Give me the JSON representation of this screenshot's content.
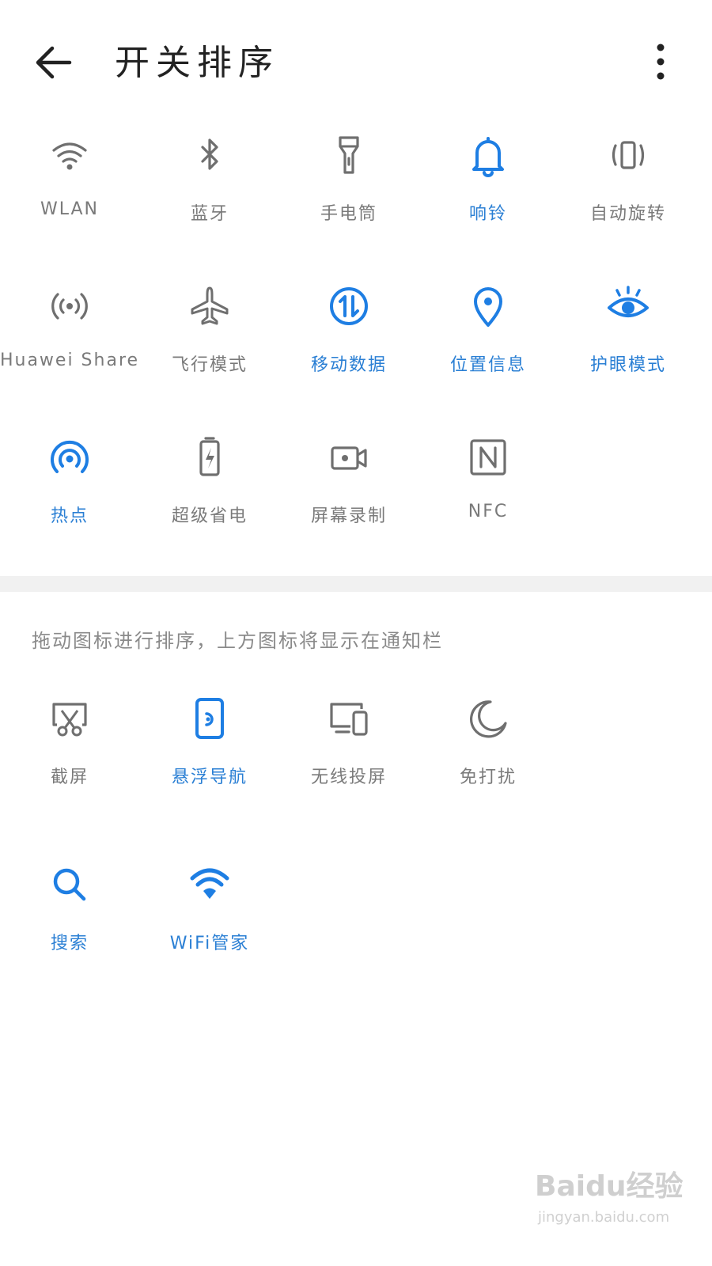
{
  "header": {
    "title": "开关排序"
  },
  "colors": {
    "active": "#1e7ee3",
    "inactive": "#6f6f6f",
    "background": "#ffffff",
    "divider": "#f1f1f1"
  },
  "top_tiles": [
    {
      "label": "WLAN",
      "icon": "wifi-icon",
      "active": false
    },
    {
      "label": "蓝牙",
      "icon": "bluetooth-icon",
      "active": false
    },
    {
      "label": "手电筒",
      "icon": "flashlight-icon",
      "active": false
    },
    {
      "label": "响铃",
      "icon": "bell-icon",
      "active": true
    },
    {
      "label": "自动旋转",
      "icon": "rotate-icon",
      "active": false
    },
    {
      "label": "Huawei Share",
      "icon": "huawei-share-icon",
      "active": false
    },
    {
      "label": "飞行模式",
      "icon": "airplane-icon",
      "active": false
    },
    {
      "label": "移动数据",
      "icon": "mobile-data-icon",
      "active": true
    },
    {
      "label": "位置信息",
      "icon": "location-icon",
      "active": true
    },
    {
      "label": "护眼模式",
      "icon": "eye-icon",
      "active": true
    },
    {
      "label": "热点",
      "icon": "hotspot-icon",
      "active": true
    },
    {
      "label": "超级省电",
      "icon": "battery-saver-icon",
      "active": false
    },
    {
      "label": "屏幕录制",
      "icon": "screen-record-icon",
      "active": false
    },
    {
      "label": "NFC",
      "icon": "nfc-icon",
      "active": false
    }
  ],
  "hint": "拖动图标进行排序，上方图标将显示在通知栏",
  "bottom_tiles": [
    {
      "label": "截屏",
      "icon": "screenshot-icon",
      "active": false
    },
    {
      "label": "悬浮导航",
      "icon": "floating-nav-icon",
      "active": true
    },
    {
      "label": "无线投屏",
      "icon": "wireless-projection-icon",
      "active": false
    },
    {
      "label": "免打扰",
      "icon": "moon-icon",
      "active": false
    },
    {
      "label": "搜索",
      "icon": "search-icon",
      "active": true
    },
    {
      "label": "WiFi管家",
      "icon": "wifi-manager-icon",
      "active": true
    }
  ],
  "watermark": {
    "logo": "Baidu经验",
    "url": "jingyan.baidu.com"
  }
}
